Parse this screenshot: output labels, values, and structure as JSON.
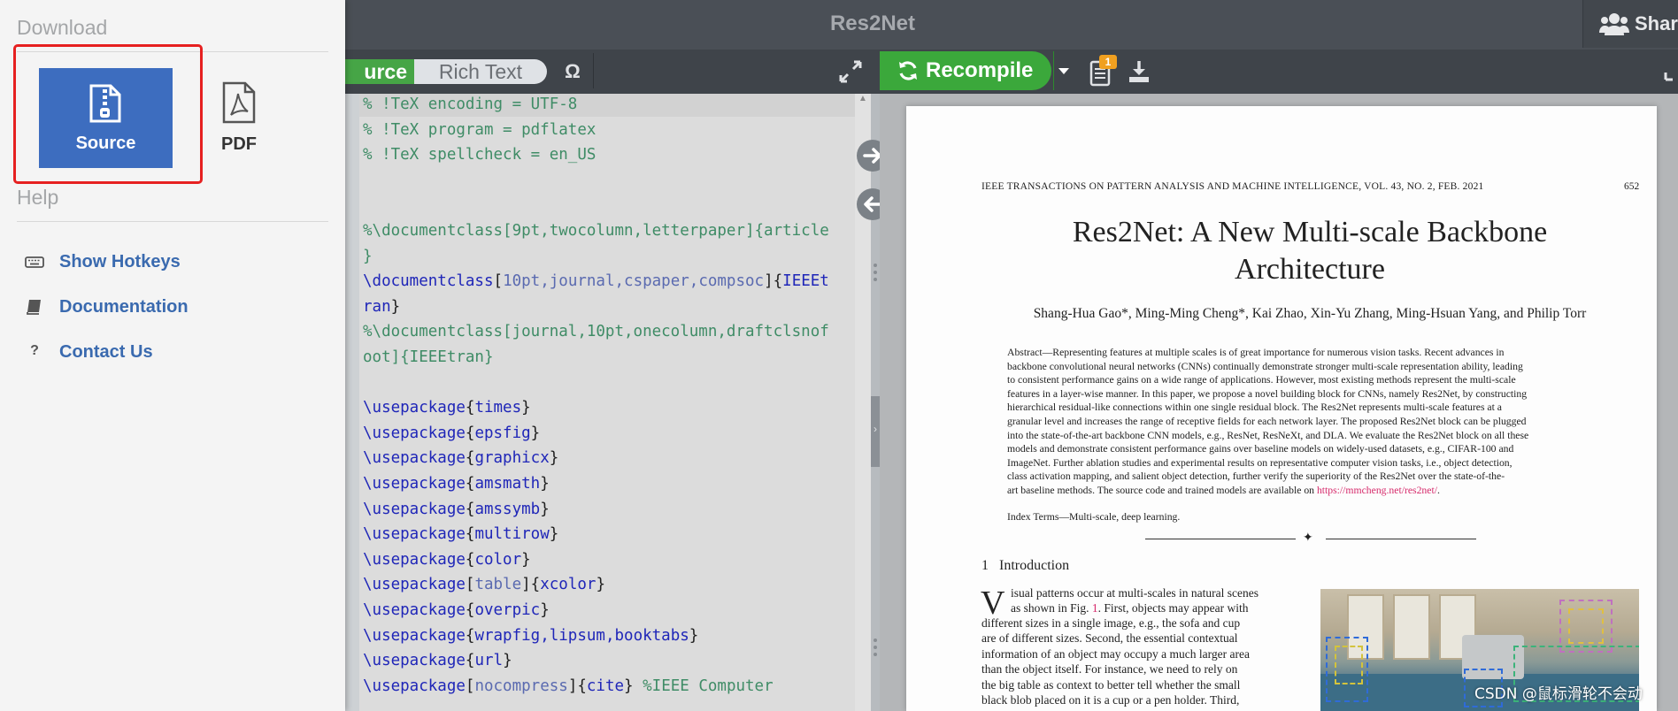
{
  "header": {
    "title": "Res2Net",
    "share_label": "Share"
  },
  "editor_toolbar": {
    "source_tab": "urce",
    "richtext_tab": "Rich Text",
    "omega_symbol": "Ω"
  },
  "pdf_toolbar": {
    "recompile_label": "Recompile",
    "logs_badge": "1"
  },
  "code_lines": [
    [
      [
        "cm",
        "% !TeX encoding = UTF-8"
      ]
    ],
    [
      [
        "cm",
        "% !TeX program = pdflatex"
      ]
    ],
    [
      [
        "cm",
        "% !TeX spellcheck = en_US"
      ]
    ],
    [],
    [],
    [
      [
        "cm",
        "%\\documentclass[9pt,twocolumn,letterpaper]{article"
      ]
    ],
    [
      [
        "cm",
        "}"
      ]
    ],
    [
      [
        "kw",
        "\\documentclass"
      ],
      [
        "tx",
        "["
      ],
      [
        "ar",
        "10pt,journal,cspaper,compsoc"
      ],
      [
        "tx",
        "]{"
      ],
      [
        "ck",
        "IEEEt"
      ]
    ],
    [
      [
        "ck",
        "ran"
      ],
      [
        "tx",
        "}"
      ]
    ],
    [
      [
        "cm",
        "%\\documentclass[journal,10pt,onecolumn,draftclsnof"
      ]
    ],
    [
      [
        "cm",
        "oot]{IEEEtran}"
      ]
    ],
    [],
    [
      [
        "kw",
        "\\usepackage"
      ],
      [
        "tx",
        "{"
      ],
      [
        "ck",
        "times"
      ],
      [
        "tx",
        "}"
      ]
    ],
    [
      [
        "kw",
        "\\usepackage"
      ],
      [
        "tx",
        "{"
      ],
      [
        "ck",
        "epsfig"
      ],
      [
        "tx",
        "}"
      ]
    ],
    [
      [
        "kw",
        "\\usepackage"
      ],
      [
        "tx",
        "{"
      ],
      [
        "ck",
        "graphicx"
      ],
      [
        "tx",
        "}"
      ]
    ],
    [
      [
        "kw",
        "\\usepackage"
      ],
      [
        "tx",
        "{"
      ],
      [
        "ck",
        "amsmath"
      ],
      [
        "tx",
        "}"
      ]
    ],
    [
      [
        "kw",
        "\\usepackage"
      ],
      [
        "tx",
        "{"
      ],
      [
        "ck",
        "amssymb"
      ],
      [
        "tx",
        "}"
      ]
    ],
    [
      [
        "kw",
        "\\usepackage"
      ],
      [
        "tx",
        "{"
      ],
      [
        "ck",
        "multirow"
      ],
      [
        "tx",
        "}"
      ]
    ],
    [
      [
        "kw",
        "\\usepackage"
      ],
      [
        "tx",
        "{"
      ],
      [
        "ck",
        "color"
      ],
      [
        "tx",
        "}"
      ]
    ],
    [
      [
        "kw",
        "\\usepackage"
      ],
      [
        "tx",
        "["
      ],
      [
        "ar",
        "table"
      ],
      [
        "tx",
        "]{"
      ],
      [
        "ck",
        "xcolor"
      ],
      [
        "tx",
        "}"
      ]
    ],
    [
      [
        "kw",
        "\\usepackage"
      ],
      [
        "tx",
        "{"
      ],
      [
        "ck",
        "overpic"
      ],
      [
        "tx",
        "}"
      ]
    ],
    [
      [
        "kw",
        "\\usepackage"
      ],
      [
        "tx",
        "{"
      ],
      [
        "ck",
        "wrapfig,lipsum,booktabs"
      ],
      [
        "tx",
        "}"
      ]
    ],
    [
      [
        "kw",
        "\\usepackage"
      ],
      [
        "tx",
        "{"
      ],
      [
        "ck",
        "url"
      ],
      [
        "tx",
        "}"
      ]
    ],
    [
      [
        "kw",
        "\\usepackage"
      ],
      [
        "tx",
        "["
      ],
      [
        "ar",
        "nocompress"
      ],
      [
        "tx",
        "]{"
      ],
      [
        "ck",
        "cite"
      ],
      [
        "tx",
        "} "
      ],
      [
        "cm",
        "%IEEE Computer"
      ]
    ]
  ],
  "pdf": {
    "journal_header": "IEEE TRANSACTIONS ON PATTERN ANALYSIS AND MACHINE INTELLIGENCE, VOL. 43, NO. 2, FEB. 2021",
    "page_number": "652",
    "title_line1": "Res2Net: A New Multi-scale Backbone",
    "title_line2": "Architecture",
    "authors": "Shang-Hua Gao*,  Ming-Ming Cheng*,  Kai Zhao,  Xin-Yu Zhang,  Ming-Hsuan Yang,  and Philip Torr",
    "abstract_lines": [
      "Abstract—Representing features at multiple scales is of great importance for numerous vision tasks. Recent advances in",
      "backbone convolutional neural networks (CNNs) continually demonstrate stronger multi-scale representation ability, leading",
      "to consistent performance gains on a wide range of applications. However, most existing methods represent the multi-scale",
      "features in a layer-wise manner. In this paper, we propose a novel building block for CNNs, namely Res2Net, by constructing",
      "hierarchical residual-like connections within one single residual block. The Res2Net represents multi-scale features at a",
      "granular level and increases the range of receptive fields for each network layer. The proposed Res2Net block can be plugged",
      "into the state-of-the-art backbone CNN models, e.g., ResNet, ResNeXt, and DLA. We evaluate the Res2Net block on all these",
      "models and demonstrate consistent performance gains over baseline models on widely-used datasets, e.g., CIFAR-100 and",
      "ImageNet. Further ablation studies and experimental results on representative computer vision tasks, i.e., object detection,",
      "class activation mapping, and salient object detection, further verify the superiority of the Res2Net over the state-of-the-"
    ],
    "abstract_last_prefix": "art baseline methods. The source code and trained models are available on ",
    "abstract_link": "https://mmcheng.net/res2net/",
    "abstract_last_suffix": ".",
    "index_terms": "Index Terms—Multi-scale, deep learning.",
    "rule_symbol": "✦",
    "section_number": "1",
    "section_title": "Introduction",
    "dropcap": "V",
    "body_first_a": "isual patterns occur at multi-scales in natural scenes",
    "body_first_b": "as shown in Fig. ",
    "body_fig_ref": "1",
    "body_first_c": ". First, objects may appear with",
    "body_lines": [
      "different sizes in a single image, e.g., the sofa and cup",
      "are of different sizes. Second, the essential contextual",
      "information of an object may occupy a much larger area",
      "than the object itself. For instance, we need to rely on",
      "the big table as context to better tell whether the small",
      "black blob placed on it is a cup or a pen holder. Third,"
    ]
  },
  "watermark": "CSDN @鼠标滑轮不会动",
  "menu": {
    "download_heading": "Download",
    "source_label": "Source",
    "pdf_label": "PDF",
    "help_heading": "Help",
    "help_items": [
      {
        "label": "Show Hotkeys",
        "icon": "keyboard-icon"
      },
      {
        "label": "Documentation",
        "icon": "book-icon"
      },
      {
        "label": "Contact Us",
        "icon": "question-icon"
      }
    ]
  },
  "colors": {
    "accent_blue": "#3d6dbf",
    "compile_green": "#3ba83b",
    "highlight_red": "#e62020"
  }
}
